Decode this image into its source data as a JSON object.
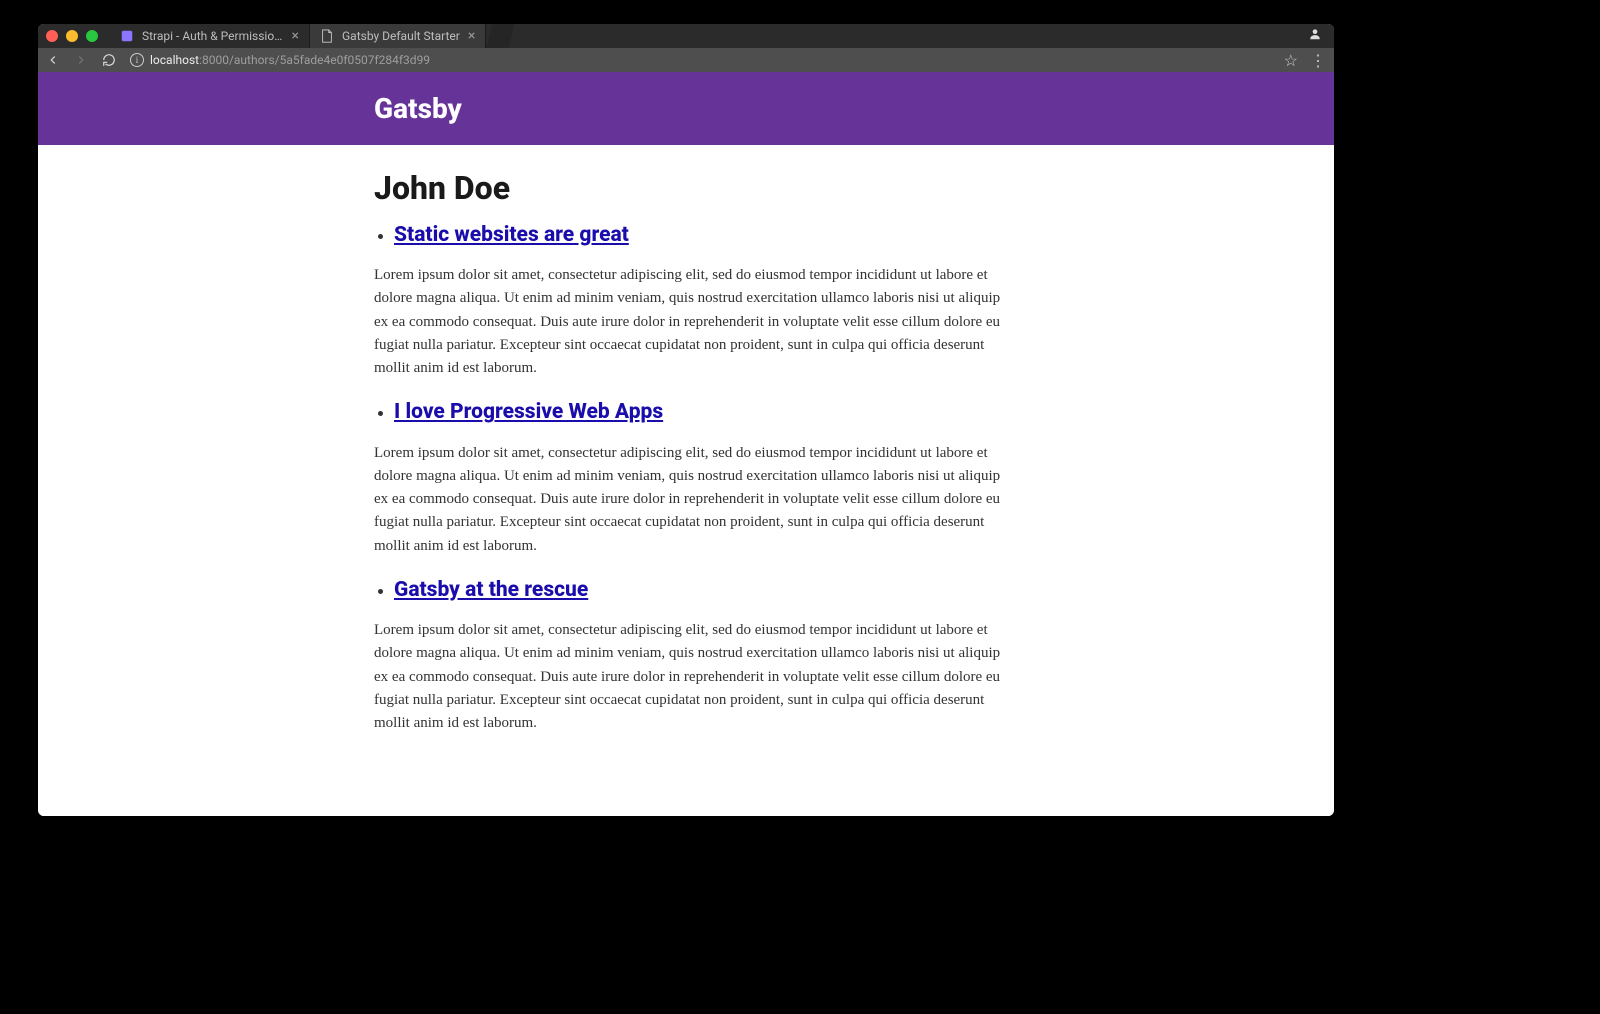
{
  "browser": {
    "tabs": [
      {
        "title": "Strapi - Auth & Permissions",
        "favicon": "strapi"
      },
      {
        "title": "Gatsby Default Starter",
        "favicon": "file",
        "active": true
      }
    ],
    "url": {
      "host": "localhost",
      "path": ":8000/authors/5a5fade4e0f0507f284f3d99"
    }
  },
  "site": {
    "brand": "Gatsby"
  },
  "page": {
    "title": "John Doe",
    "articles": [
      {
        "title": "Static websites are great",
        "body": "Lorem ipsum dolor sit amet, consectetur adipiscing elit, sed do eiusmod tempor incididunt ut labore et dolore magna aliqua. Ut enim ad minim veniam, quis nostrud exercitation ullamco laboris nisi ut aliquip ex ea commodo consequat. Duis aute irure dolor in reprehenderit in voluptate velit esse cillum dolore eu fugiat nulla pariatur. Excepteur sint occaecat cupidatat non proident, sunt in culpa qui officia deserunt mollit anim id est laborum."
      },
      {
        "title": "I love Progressive Web Apps",
        "body": "Lorem ipsum dolor sit amet, consectetur adipiscing elit, sed do eiusmod tempor incididunt ut labore et dolore magna aliqua. Ut enim ad minim veniam, quis nostrud exercitation ullamco laboris nisi ut aliquip ex ea commodo consequat. Duis aute irure dolor in reprehenderit in voluptate velit esse cillum dolore eu fugiat nulla pariatur. Excepteur sint occaecat cupidatat non proident, sunt in culpa qui officia deserunt mollit anim id est laborum."
      },
      {
        "title": "Gatsby at the rescue",
        "body": "Lorem ipsum dolor sit amet, consectetur adipiscing elit, sed do eiusmod tempor incididunt ut labore et dolore magna aliqua. Ut enim ad minim veniam, quis nostrud exercitation ullamco laboris nisi ut aliquip ex ea commodo consequat. Duis aute irure dolor in reprehenderit in voluptate velit esse cillum dolore eu fugiat nulla pariatur. Excepteur sint occaecat cupidatat non proident, sunt in culpa qui officia deserunt mollit anim id est laborum."
      }
    ]
  }
}
